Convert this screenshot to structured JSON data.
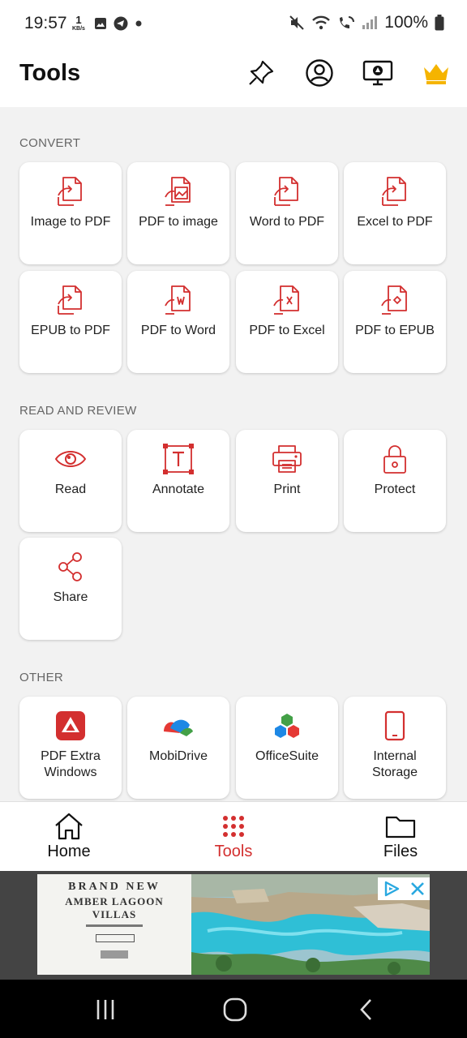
{
  "status_bar": {
    "time": "19:57",
    "net_speed_value": "1",
    "net_speed_unit": "KB/s",
    "battery": "100%"
  },
  "header": {
    "title": "Tools",
    "icons": [
      "pin-icon",
      "account-icon",
      "screen-share-icon",
      "crown-icon"
    ]
  },
  "sections": {
    "convert": {
      "label": "CONVERT",
      "items": [
        {
          "label": "Image to PDF",
          "icon": "image-to-pdf-icon"
        },
        {
          "label": "PDF to image",
          "icon": "pdf-to-image-icon"
        },
        {
          "label": "Word to PDF",
          "icon": "word-to-pdf-icon"
        },
        {
          "label": "Excel to PDF",
          "icon": "excel-to-pdf-icon"
        },
        {
          "label": "EPUB to PDF",
          "icon": "epub-to-pdf-icon"
        },
        {
          "label": "PDF to Word",
          "icon": "pdf-to-word-icon"
        },
        {
          "label": "PDF to Excel",
          "icon": "pdf-to-excel-icon"
        },
        {
          "label": "PDF to EPUB",
          "icon": "pdf-to-epub-icon"
        }
      ]
    },
    "read_review": {
      "label": "READ AND REVIEW",
      "items": [
        {
          "label": "Read",
          "icon": "eye-icon"
        },
        {
          "label": "Annotate",
          "icon": "text-annotate-icon"
        },
        {
          "label": "Print",
          "icon": "printer-icon"
        },
        {
          "label": "Protect",
          "icon": "lock-icon"
        },
        {
          "label": "Share",
          "icon": "share-icon"
        }
      ]
    },
    "other": {
      "label": "OTHER",
      "items": [
        {
          "label": "PDF Extra Windows",
          "icon": "pdf-extra-logo-icon"
        },
        {
          "label": "MobiDrive",
          "icon": "mobidrive-logo-icon"
        },
        {
          "label": "OfficeSuite",
          "icon": "officesuite-logo-icon"
        },
        {
          "label": "Internal Storage",
          "icon": "phone-storage-icon"
        }
      ]
    }
  },
  "bottom_nav": {
    "home": "Home",
    "tools": "Tools",
    "files": "Files",
    "active": "tools"
  },
  "ad": {
    "line1": "BRAND NEW",
    "line2": "AMBER LAGOON",
    "line3": "VILLAS"
  },
  "colors": {
    "accent": "#d32f2f",
    "crown": "#f5b400",
    "background": "#f2f2f2",
    "card": "#ffffff"
  }
}
